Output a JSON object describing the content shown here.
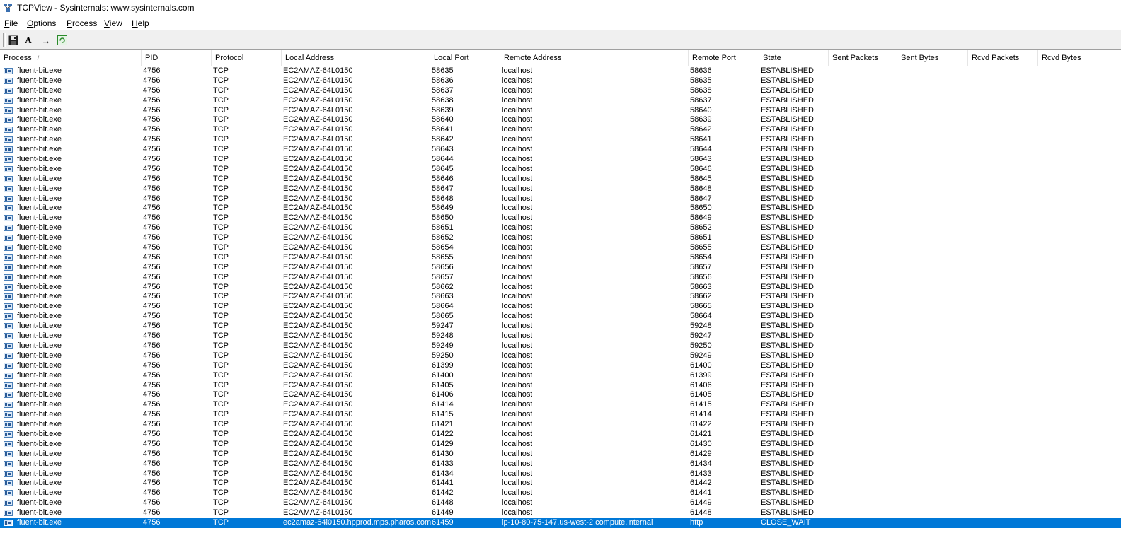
{
  "window": {
    "title": "TCPView - Sysinternals: www.sysinternals.com"
  },
  "menu": [
    {
      "label": "File",
      "key": "F",
      "rest": "ile"
    },
    {
      "label": "Options",
      "key": "O",
      "rest": "ptions"
    },
    {
      "label": "Process",
      "key": "P",
      "rest": "rocess"
    },
    {
      "label": "View",
      "key": "V",
      "rest": "iew"
    },
    {
      "label": "Help",
      "key": "H",
      "rest": "elp"
    }
  ],
  "toolbar": {
    "save_icon": "floppy-disk-icon",
    "font_label": "A",
    "resolve_label": "→",
    "refresh_icon": "refresh-icon"
  },
  "columns": [
    "Process",
    "PID",
    "Protocol",
    "Local Address",
    "Local Port",
    "Remote Address",
    "Remote Port",
    "State",
    "Sent Packets",
    "Sent Bytes",
    "Rcvd Packets",
    "Rcvd Bytes"
  ],
  "sort": {
    "column": "Process",
    "indicator": "/"
  },
  "defaults": {
    "process": "fluent-bit.exe",
    "pid": "4756",
    "protocol": "TCP",
    "local_address": "EC2AMAZ-64L0150",
    "remote_address": "localhost",
    "state": "ESTABLISHED"
  },
  "rows": [
    [
      "58635",
      "58636"
    ],
    [
      "58636",
      "58635"
    ],
    [
      "58637",
      "58638"
    ],
    [
      "58638",
      "58637"
    ],
    [
      "58639",
      "58640"
    ],
    [
      "58640",
      "58639"
    ],
    [
      "58641",
      "58642"
    ],
    [
      "58642",
      "58641"
    ],
    [
      "58643",
      "58644"
    ],
    [
      "58644",
      "58643"
    ],
    [
      "58645",
      "58646"
    ],
    [
      "58646",
      "58645"
    ],
    [
      "58647",
      "58648"
    ],
    [
      "58648",
      "58647"
    ],
    [
      "58649",
      "58650"
    ],
    [
      "58650",
      "58649"
    ],
    [
      "58651",
      "58652"
    ],
    [
      "58652",
      "58651"
    ],
    [
      "58654",
      "58655"
    ],
    [
      "58655",
      "58654"
    ],
    [
      "58656",
      "58657"
    ],
    [
      "58657",
      "58656"
    ],
    [
      "58662",
      "58663"
    ],
    [
      "58663",
      "58662"
    ],
    [
      "58664",
      "58665"
    ],
    [
      "58665",
      "58664"
    ],
    [
      "59247",
      "59248"
    ],
    [
      "59248",
      "59247"
    ],
    [
      "59249",
      "59250"
    ],
    [
      "59250",
      "59249"
    ],
    [
      "61399",
      "61400"
    ],
    [
      "61400",
      "61399"
    ],
    [
      "61405",
      "61406"
    ],
    [
      "61406",
      "61405"
    ],
    [
      "61414",
      "61415"
    ],
    [
      "61415",
      "61414"
    ],
    [
      "61421",
      "61422"
    ],
    [
      "61422",
      "61421"
    ],
    [
      "61429",
      "61430"
    ],
    [
      "61430",
      "61429"
    ],
    [
      "61433",
      "61434"
    ],
    [
      "61434",
      "61433"
    ],
    [
      "61441",
      "61442"
    ],
    [
      "61442",
      "61441"
    ],
    [
      "61448",
      "61449"
    ],
    [
      "61449",
      "61448"
    ]
  ],
  "selected_row": {
    "process": "fluent-bit.exe",
    "pid": "4756",
    "protocol": "TCP",
    "local_address": "ec2amaz-64l0150.hpprod.mps.pharos.com",
    "local_port": "61459",
    "remote_address": "ip-10-80-75-147.us-west-2.compute.internal",
    "remote_port": "http",
    "state": "CLOSE_WAIT"
  },
  "colors": {
    "selection": "#0078d7"
  }
}
